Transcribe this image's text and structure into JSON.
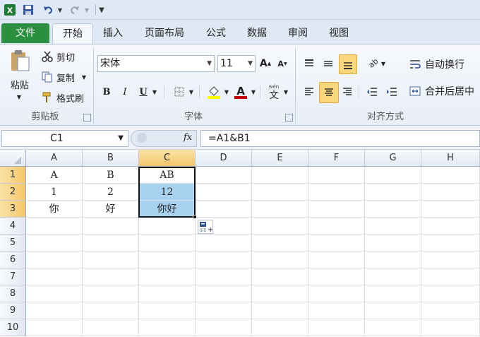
{
  "qat": {
    "excel_icon": "excel-icon",
    "save_icon": "save-icon",
    "undo_icon": "undo-icon",
    "redo_icon": "redo-icon",
    "customize_icon": "customize-qat-icon"
  },
  "tabs": [
    {
      "label": "文件"
    },
    {
      "label": "开始"
    },
    {
      "label": "插入"
    },
    {
      "label": "页面布局"
    },
    {
      "label": "公式"
    },
    {
      "label": "数据"
    },
    {
      "label": "审阅"
    },
    {
      "label": "视图"
    }
  ],
  "ribbon": {
    "clipboard": {
      "paste": "粘贴",
      "cut": "剪切",
      "copy": "复制",
      "format_painter": "格式刷",
      "group_label": "剪贴板"
    },
    "font": {
      "font_name": "宋体",
      "font_size": "11",
      "bold": "B",
      "italic": "I",
      "underline": "U",
      "group_label": "字体",
      "font_color": "#c00000",
      "highlight_color": "#ffff00"
    },
    "alignment": {
      "wrap_text": "自动换行",
      "merge_center": "合并后居中",
      "group_label": "对齐方式"
    }
  },
  "formula_bar": {
    "name_box": "C1",
    "fx": "fx",
    "formula": "=A1&B1"
  },
  "grid": {
    "columns": [
      "A",
      "B",
      "C",
      "D",
      "E",
      "F",
      "G",
      "H"
    ],
    "rows": [
      "1",
      "2",
      "3",
      "4",
      "5",
      "6",
      "7",
      "8",
      "9",
      "10"
    ],
    "cells": {
      "A1": "A",
      "B1": "B",
      "C1": "AB",
      "A2": "1",
      "B2": "2",
      "C2": "12",
      "A3": "你",
      "B3": "好",
      "C3": "你好"
    },
    "selected_column": "C",
    "selected_rows": [
      "1",
      "2",
      "3"
    ]
  },
  "accent": {
    "file_tab": "#2a8f3e",
    "selection": "#a9d1f0",
    "header_highlight": "#f5c66b"
  }
}
